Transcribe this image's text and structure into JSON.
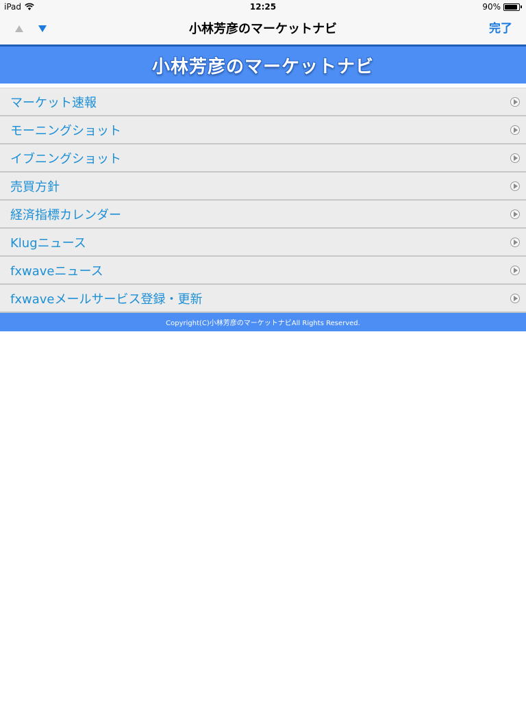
{
  "status": {
    "device": "iPad",
    "time": "12:25",
    "battery": "90%",
    "battery_level": 0.9
  },
  "nav": {
    "title": "小林芳彦のマーケットナビ",
    "done_label": "完了"
  },
  "banner": {
    "title": "小林芳彦のマーケットナビ"
  },
  "menu": {
    "items": [
      {
        "label": "マーケット速報"
      },
      {
        "label": "モーニングショット"
      },
      {
        "label": "イブニングショット"
      },
      {
        "label": "売買方針"
      },
      {
        "label": "経済指標カレンダー"
      },
      {
        "label": "Klugニュース"
      },
      {
        "label": "fxwaveニュース"
      },
      {
        "label": "fxwaveメールサービス登録・更新"
      }
    ]
  },
  "footer": {
    "copyright": "Copyright(C)小林芳彦のマーケットナビAll Rights Reserved."
  },
  "colors": {
    "accent": "#1a7ae0",
    "link": "#1c8fd6",
    "banner": "#4d8ef5",
    "nav_border": "#1f5fb8"
  }
}
